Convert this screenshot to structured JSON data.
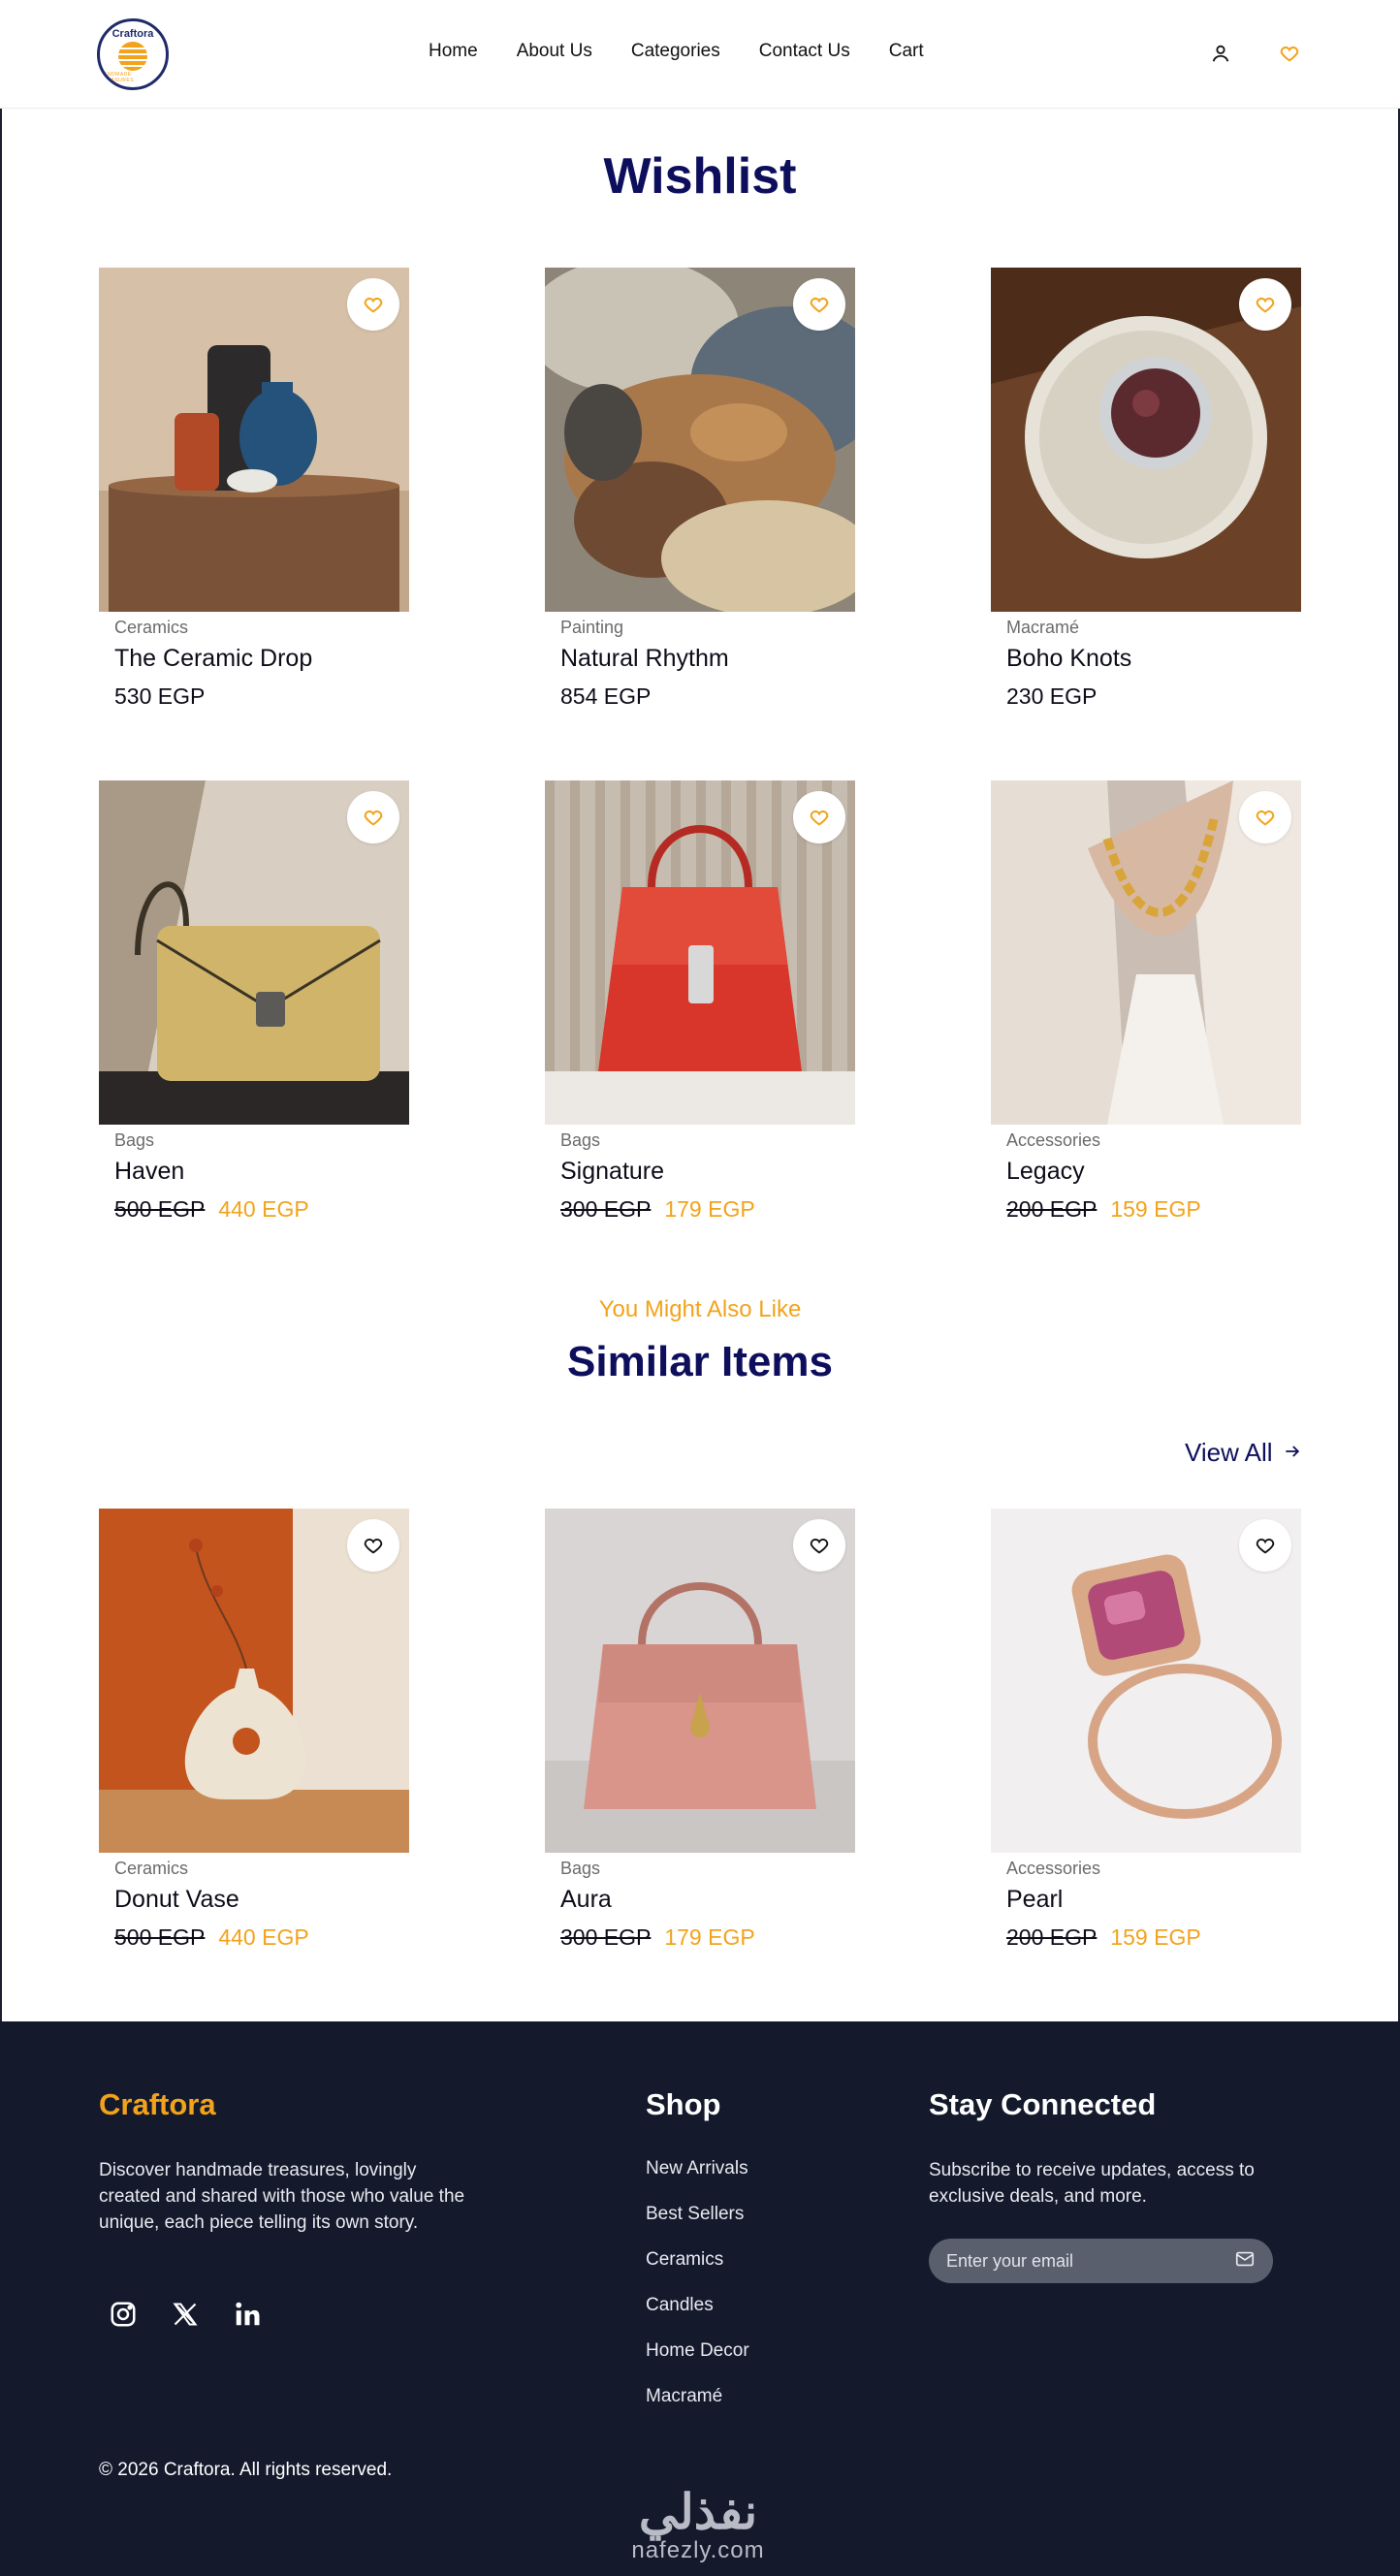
{
  "header": {
    "logo_text": "Craftora",
    "logo_tagline": "HANDMADE TREASURES",
    "nav": [
      "Home",
      "About Us",
      "Categories",
      "Contact Us",
      "Cart"
    ],
    "icons": [
      "user-icon",
      "heart-icon"
    ]
  },
  "wishlist": {
    "title": "Wishlist",
    "items": [
      {
        "category": "Ceramics",
        "name": "The Ceramic Drop",
        "price": "530 EGP"
      },
      {
        "category": "Painting",
        "name": "Natural Rhythm",
        "price": "854 EGP"
      },
      {
        "category": "Macramé",
        "name": "Boho Knots",
        "price": "230 EGP"
      },
      {
        "category": "Bags",
        "name": "Haven",
        "old_price": "500 EGP",
        "price": "440 EGP"
      },
      {
        "category": "Bags",
        "name": "Signature",
        "old_price": "300 EGP",
        "price": "179 EGP"
      },
      {
        "category": "Accessories",
        "name": "Legacy",
        "old_price": "200 EGP",
        "price": "159 EGP"
      }
    ]
  },
  "similar": {
    "subtitle": "You Might Also Like",
    "title": "Similar Items",
    "view_all": "View All",
    "items": [
      {
        "category": "Ceramics",
        "name": "Donut Vase",
        "old_price": "500 EGP",
        "price": "440 EGP"
      },
      {
        "category": "Bags",
        "name": "Aura",
        "old_price": "300 EGP",
        "price": "179 EGP"
      },
      {
        "category": "Accessories",
        "name": "Pearl",
        "old_price": "200 EGP",
        "price": "159 EGP"
      }
    ]
  },
  "footer": {
    "brand": "Craftora",
    "description": "Discover handmade treasures, lovingly created and shared with those who value the unique, each piece telling its own story.",
    "social": [
      "instagram-icon",
      "x-icon",
      "linkedin-icon"
    ],
    "shop_heading": "Shop",
    "shop_links": [
      "New Arrivals",
      "Best Sellers",
      "Ceramics",
      "Candles",
      "Home Decor",
      "Macramé"
    ],
    "stay_heading": "Stay Connected",
    "stay_description": "Subscribe to receive updates, access to exclusive deals, and more.",
    "email_placeholder": "Enter your email",
    "copyright": "© 2026 Craftora. All rights reserved.",
    "watermark_ar": "نفذلي",
    "watermark_en": "nafezly.com"
  },
  "colors": {
    "accent": "#f2a31b",
    "navy": "#0e0f5c",
    "footer_bg": "#141a2c"
  }
}
